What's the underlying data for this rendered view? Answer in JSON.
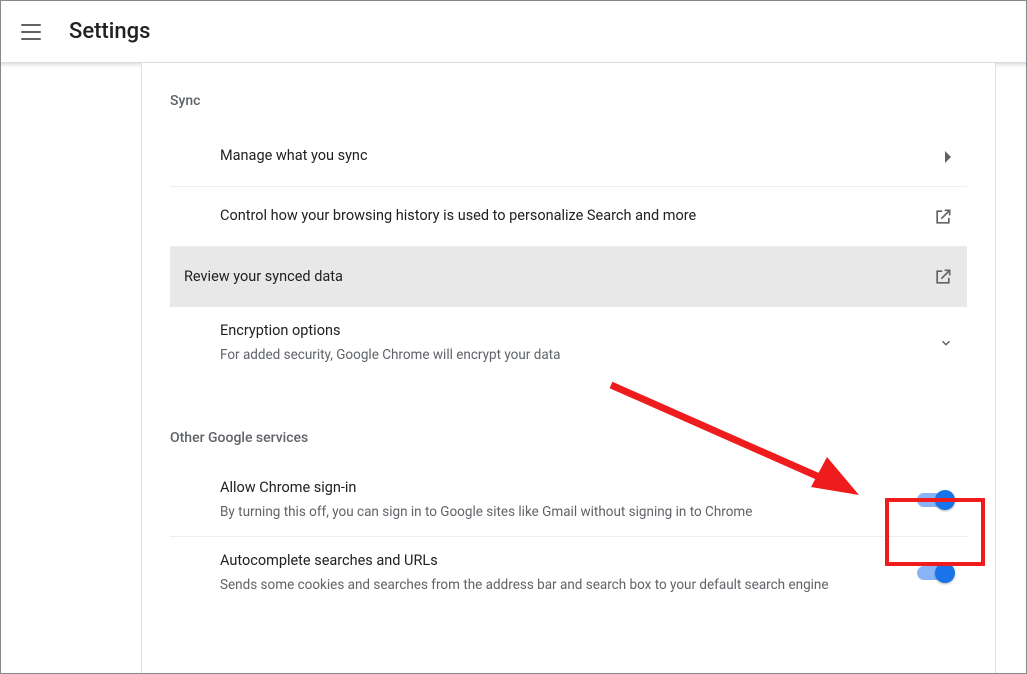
{
  "header": {
    "title": "Settings"
  },
  "sync": {
    "section_title": "Sync",
    "manage": "Manage what you sync",
    "control": "Control how your browsing history is used to personalize Search and more",
    "review": "Review your synced data",
    "encryption_title": "Encryption options",
    "encryption_sub": "For added security, Google Chrome will encrypt your data"
  },
  "other": {
    "section_title": "Other Google services",
    "signin_title": "Allow Chrome sign-in",
    "signin_sub": "By turning this off, you can sign in to Google sites like Gmail without signing in to Chrome",
    "autocomplete_title": "Autocomplete searches and URLs",
    "autocomplete_sub": "Sends some cookies and searches from the address bar and search box to your default search engine"
  }
}
